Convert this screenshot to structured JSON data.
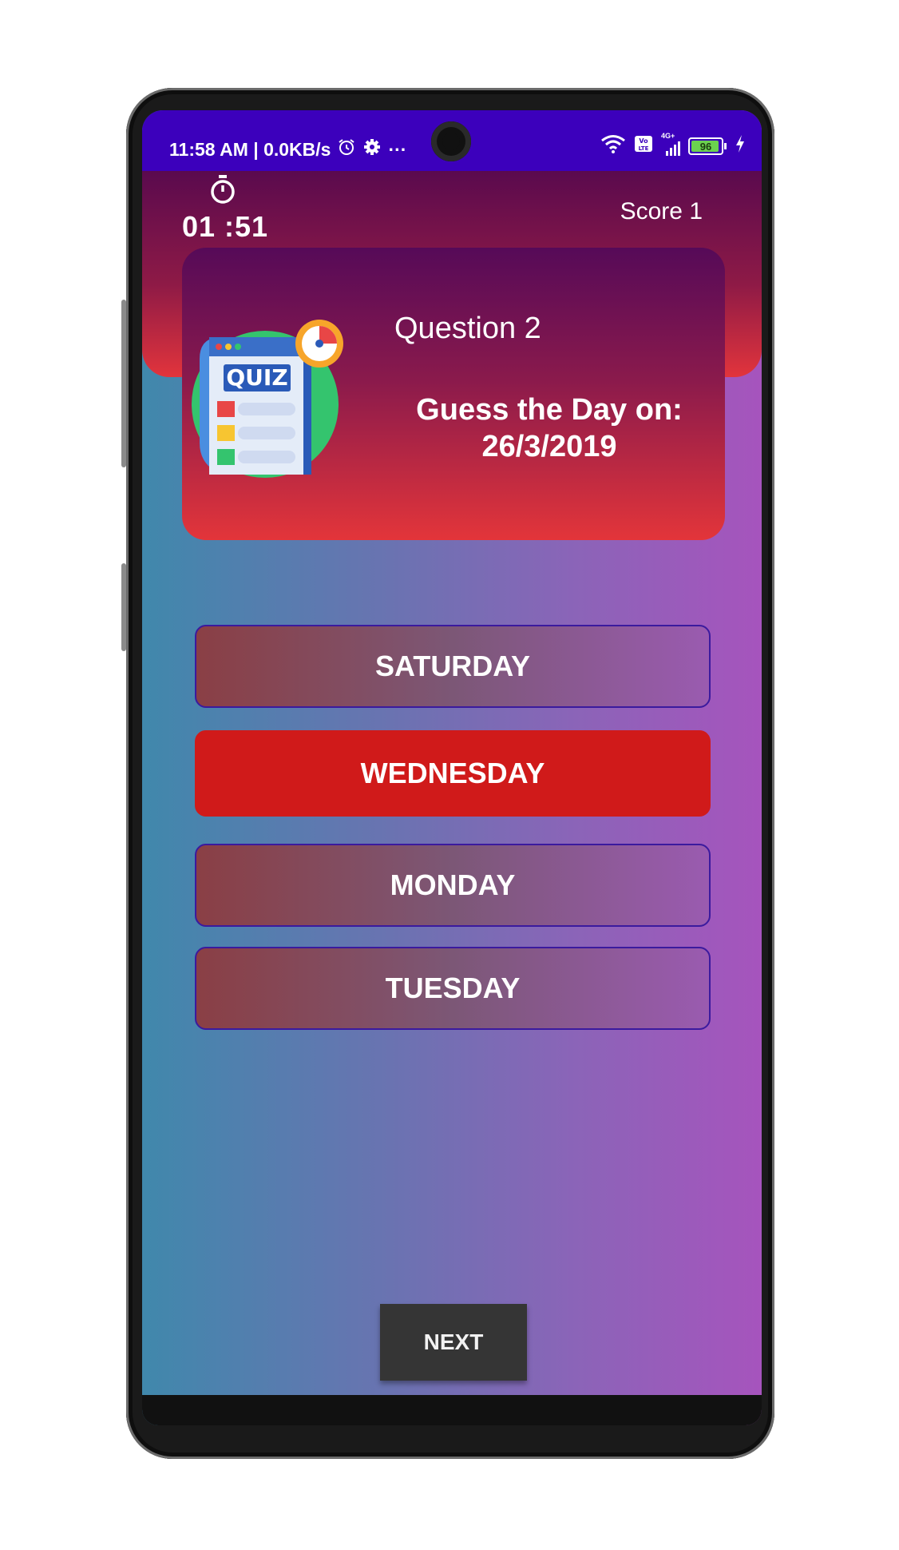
{
  "status_bar": {
    "time_speed": "11:58 AM | 0.0KB/s",
    "more": "···",
    "battery": "96",
    "network": "4G+"
  },
  "timer": {
    "value": "01 :51"
  },
  "score": {
    "label": "Score 1"
  },
  "question": {
    "title": "Question 2",
    "text_line1": "Guess the Day on:",
    "text_line2": "26/3/2019"
  },
  "quiz_image": {
    "label": "QUIZ"
  },
  "options": [
    {
      "label": "SATURDAY",
      "selected": false
    },
    {
      "label": "WEDNESDAY",
      "selected": true
    },
    {
      "label": "MONDAY",
      "selected": false
    },
    {
      "label": "TUESDAY",
      "selected": false
    }
  ],
  "next_button": {
    "label": "NEXT"
  },
  "colors": {
    "status_bar": "#3c00bc",
    "selected_option": "#d01a1a",
    "next_button": "#353535"
  }
}
